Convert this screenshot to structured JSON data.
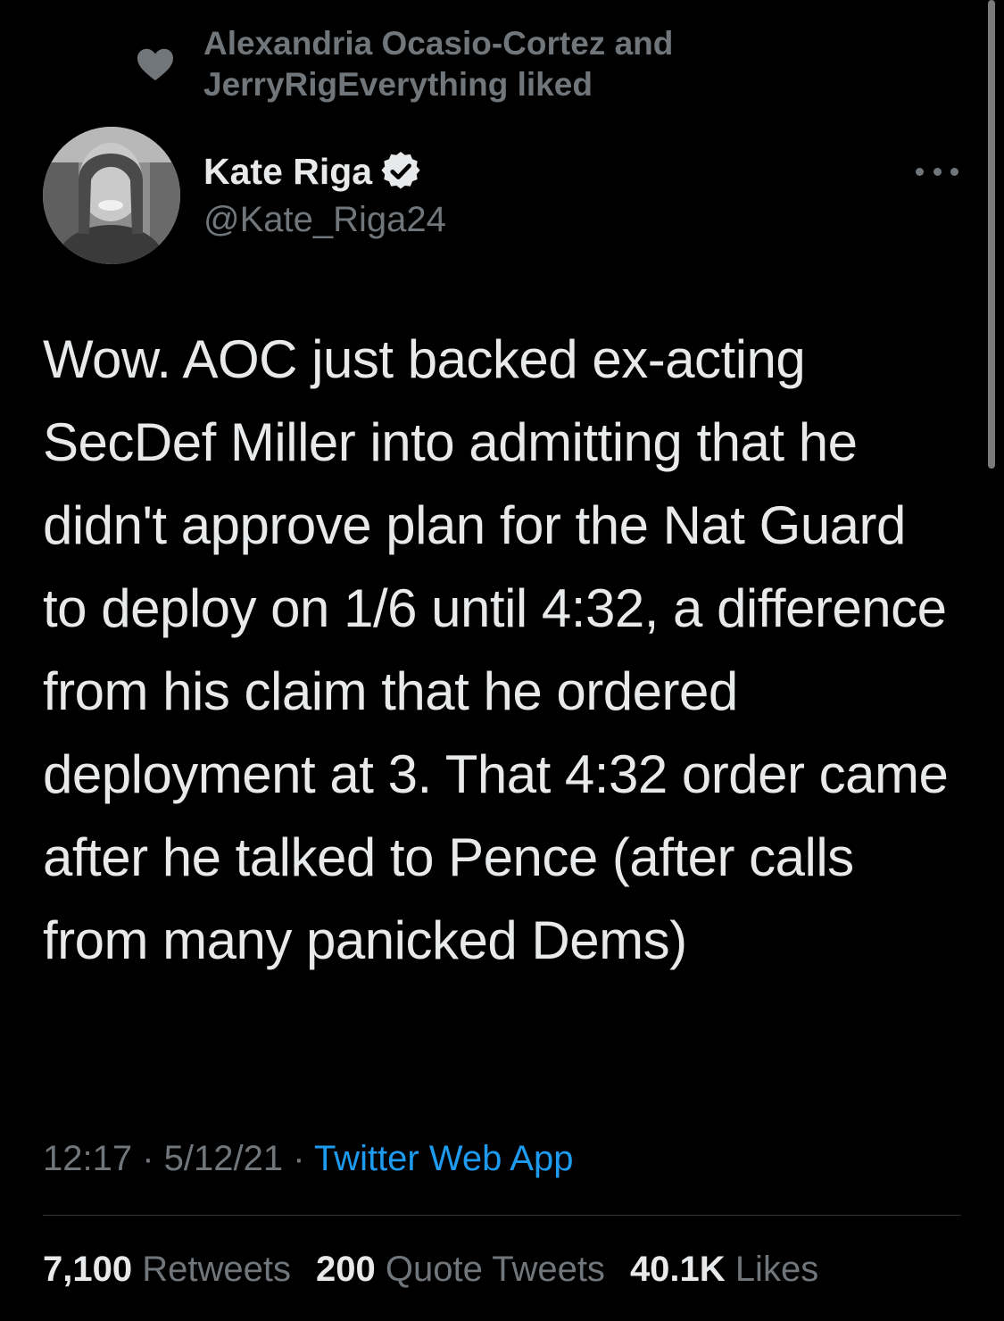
{
  "social_context": {
    "text": "Alexandria Ocasio-Cortez and JerryRigEverything liked",
    "icon": "heart-icon"
  },
  "author": {
    "name": "Kate Riga",
    "handle": "@Kate_Riga24",
    "verified": true
  },
  "tweet": {
    "text": "Wow. AOC just backed ex-acting SecDef Miller into admitting that he didn't approve plan for the Nat Guard to deploy on 1/6 until 4:32, a difference from his claim that he ordered deployment at 3. That 4:32 order came after he talked to Pence (after calls from many panicked Dems)"
  },
  "meta": {
    "time": "12:17",
    "separator": " · ",
    "date": "5/12/21",
    "source": "Twitter Web App"
  },
  "stats": {
    "retweets_count": "7,100",
    "retweets_label": "Retweets",
    "quotes_count": "200",
    "quotes_label": "Quote Tweets",
    "likes_count": "40.1K",
    "likes_label": "Likes"
  },
  "colors": {
    "background": "#000000",
    "secondary_text": "#71767b",
    "link": "#1d9bf0"
  }
}
